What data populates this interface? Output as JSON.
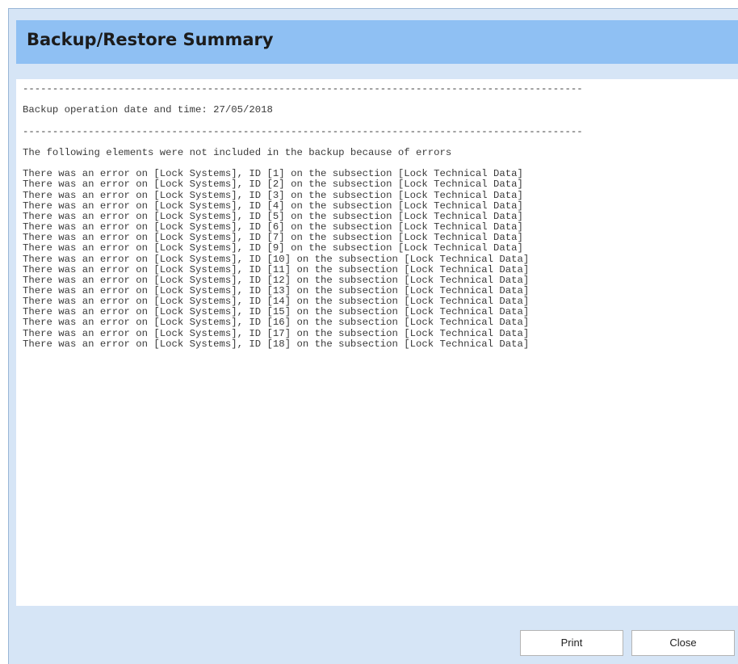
{
  "dialog": {
    "title": "Backup/Restore Summary"
  },
  "summary": {
    "separator": "----------------------------------------------------------------------------------------------",
    "date_line": "Backup operation date and time: 27/05/2018",
    "intro_line": "The following elements were not included in the backup because of errors",
    "error_lines": [
      "There was an error on [Lock Systems], ID [1] on the subsection [Lock Technical Data]",
      "There was an error on [Lock Systems], ID [2] on the subsection [Lock Technical Data]",
      "There was an error on [Lock Systems], ID [3] on the subsection [Lock Technical Data]",
      "There was an error on [Lock Systems], ID [4] on the subsection [Lock Technical Data]",
      "There was an error on [Lock Systems], ID [5] on the subsection [Lock Technical Data]",
      "There was an error on [Lock Systems], ID [6] on the subsection [Lock Technical Data]",
      "There was an error on [Lock Systems], ID [7] on the subsection [Lock Technical Data]",
      "There was an error on [Lock Systems], ID [9] on the subsection [Lock Technical Data]",
      "There was an error on [Lock Systems], ID [10] on the subsection [Lock Technical Data]",
      "There was an error on [Lock Systems], ID [11] on the subsection [Lock Technical Data]",
      "There was an error on [Lock Systems], ID [12] on the subsection [Lock Technical Data]",
      "There was an error on [Lock Systems], ID [13] on the subsection [Lock Technical Data]",
      "There was an error on [Lock Systems], ID [14] on the subsection [Lock Technical Data]",
      "There was an error on [Lock Systems], ID [15] on the subsection [Lock Technical Data]",
      "There was an error on [Lock Systems], ID [16] on the subsection [Lock Technical Data]",
      "There was an error on [Lock Systems], ID [17] on the subsection [Lock Technical Data]",
      "There was an error on [Lock Systems], ID [18] on the subsection [Lock Technical Data]"
    ]
  },
  "buttons": {
    "print_label": "Print",
    "close_label": "Close"
  },
  "colors": {
    "header_background": "#8fc0f3",
    "dialog_background": "#d6e5f6",
    "text": "#3a3a3a"
  }
}
